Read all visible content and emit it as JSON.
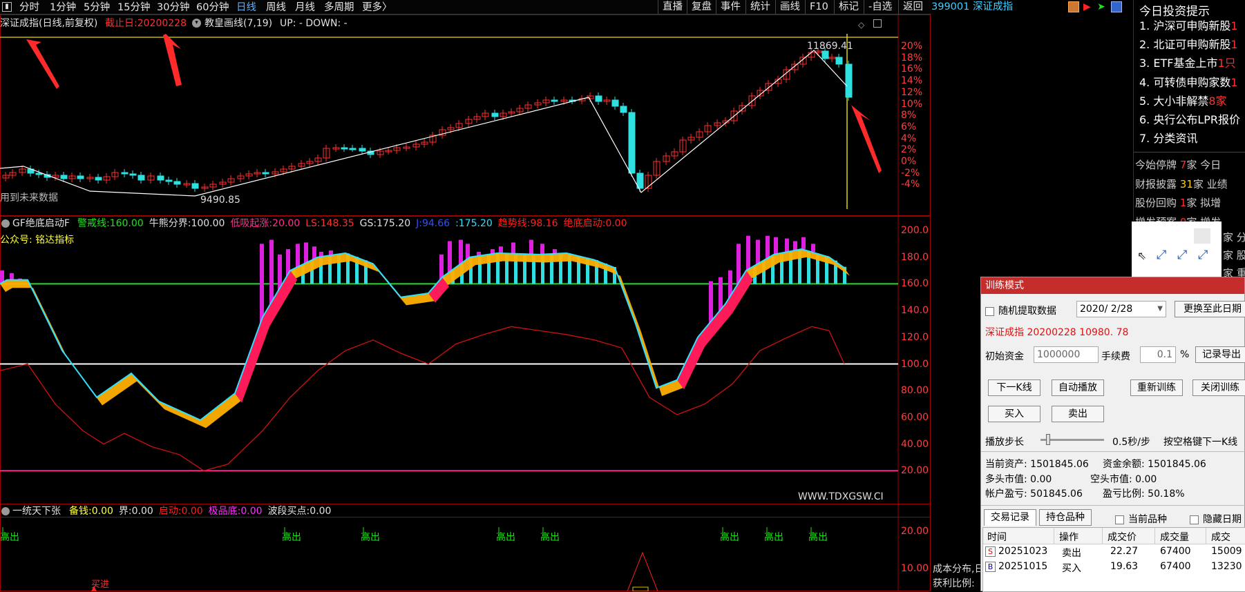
{
  "toolbar": {
    "menu_icon": "menu-icon",
    "timeframes": [
      "分时",
      "1分钟",
      "5分钟",
      "15分钟",
      "30分钟",
      "60分钟",
      "日线",
      "周线",
      "月线",
      "多周期",
      "更多〉"
    ],
    "active_timeframe": "日线",
    "right_buttons": [
      "直播",
      "复盘",
      "事件",
      "统计",
      "画线",
      "F10",
      "标记",
      "-自选",
      "返回"
    ],
    "code_name": "399001 深证成指"
  },
  "main_chart": {
    "title": "深证成指(日线,前复权)",
    "end_date_label": "截止日:20200228",
    "indicator": "教皇画线(7,19)",
    "up_down": "UP: -  DOWN: -",
    "high_label": "11869.41",
    "low_label": "9490.85",
    "no_future_data": "用到未来数据",
    "y_ticks": [
      "20%",
      "18%",
      "16%",
      "14%",
      "12%",
      "10%",
      "8%",
      "6%",
      "4%",
      "2%",
      "0%",
      "-2%",
      "-4%"
    ]
  },
  "gf_panel": {
    "name": "GF绝底启动F",
    "items": [
      {
        "label": "警戒线:",
        "value": "160.00",
        "color": "#20e020"
      },
      {
        "label": "牛熊分界:",
        "value": "100.00",
        "color": "#e0e0e0"
      },
      {
        "label": "低吸起涨:",
        "value": "20.00",
        "color": "#ff3090"
      },
      {
        "label": "LS:",
        "value": "148.35",
        "color": "#ff3030"
      },
      {
        "label": "GS:",
        "value": "175.20",
        "color": "#e0e0e0"
      },
      {
        "label": "J:",
        "value": "94.66",
        "color": "#3050ff"
      },
      {
        "label": ":",
        "value": "175.20",
        "color": "#30e0ff"
      },
      {
        "label": "趋势线:",
        "value": "98.16",
        "color": "#ff2020"
      },
      {
        "label": "绝底启动:",
        "value": "0.00",
        "color": "#ff2020"
      }
    ],
    "subtitle": "公众号: 铭达指标",
    "y_ticks": [
      "200.0",
      "180.0",
      "160.0",
      "140.0",
      "120.0",
      "100.0",
      "80.00",
      "60.00",
      "40.00",
      "20.00"
    ],
    "watermark": "WWW.TDXGSW.CI"
  },
  "ytx_panel": {
    "name": "一统天下张",
    "items": [
      {
        "label": "备钱:",
        "value": "0.00",
        "color": "#ffff40"
      },
      {
        "label": "界:",
        "value": "0.00",
        "color": "#e0e0e0"
      },
      {
        "label": "启动:",
        "value": "0.00",
        "color": "#ff2020"
      },
      {
        "label": "极品底:",
        "value": "0.00",
        "color": "#ff30ff"
      },
      {
        "label": "波段买点:",
        "value": "0.00",
        "color": "#e0e0e0"
      }
    ],
    "y_ticks": [
      "20.00",
      "10.00"
    ],
    "high_out": "高出",
    "buy_marker": "买进",
    "cost_dist": "成本分布,日",
    "profit_ratio": "获利比例:"
  },
  "right_panel": {
    "title": "今日投资提示",
    "tips": [
      {
        "text": "1. 沪深可申购新股",
        "num": "1"
      },
      {
        "text": "2. 北证可申购新股",
        "num": "1"
      },
      {
        "text": "3. ETF基金上市",
        "num": "1只"
      },
      {
        "text": "4. 可转债申购家数",
        "num": "1"
      },
      {
        "text": "5. 大小非解禁",
        "num": "8家"
      },
      {
        "text": "6. 央行公布LPR报价",
        "num": ""
      },
      {
        "text": "7. 分类资讯",
        "num": ""
      }
    ],
    "stats": [
      {
        "label": "今始停牌",
        "num": "7",
        "suffix": "家 今日"
      },
      {
        "label": "财报披露",
        "num": "31",
        "suffix": "家 业绩"
      },
      {
        "label": "股份回购",
        "num": "1",
        "suffix": "家 拟增"
      },
      {
        "label": "增发预案",
        "num": "0",
        "suffix": "家 增发"
      }
    ],
    "overflow": [
      "家 分红",
      "家 股东",
      "家 重组"
    ]
  },
  "dialog": {
    "title": "训练模式",
    "random_label": "随机提取数据",
    "date_value": "2020/ 2/28",
    "switch_button": "更换至此日期",
    "index_info": "深证成指  20200228  10980. 78",
    "initial_fund_label": "初始资金",
    "initial_fund": "1000000",
    "fee_label": "手续费",
    "fee": "0.1",
    "percent": "%",
    "export_button": "记录导出",
    "next_k": "下一K线",
    "auto_play": "自动播放",
    "retrain": "重新训练",
    "close_train": "关闭训练",
    "buy": "买入",
    "sell": "卖出",
    "step_label": "播放步长",
    "step_value": "0.5秒/步",
    "space_hint": "按空格键下一K线",
    "total_assets": "当前资产: 1501845.06",
    "cash_balance": "资金余额: 1501845.06",
    "long_value": "多头市值: 0.00",
    "short_value": "空头市值: 0.00",
    "account_pnl": "帐户盈亏: 501845.06",
    "pnl_ratio": "盈亏比例: 50.18%",
    "tabs": [
      "交易记录",
      "持仓品种"
    ],
    "current_only": "当前品种",
    "hide_date": "隐藏日期",
    "columns": [
      "时间",
      "操作",
      "成交价",
      "成交量",
      "成交"
    ],
    "rows": [
      {
        "flag": "S",
        "date": "20251023",
        "op": "卖出",
        "price": "22.27",
        "qty": "67400",
        "amt": "15009"
      },
      {
        "flag": "B",
        "date": "20251015",
        "op": "买入",
        "price": "19.63",
        "qty": "67400",
        "amt": "13230"
      }
    ]
  },
  "colors": {
    "up": "#ff3030",
    "down": "#30e0e0",
    "axis_red": "#ff4040",
    "alert_green": "#20e020",
    "bull_line": "#ffffff",
    "low_pink": "#ff2090"
  }
}
